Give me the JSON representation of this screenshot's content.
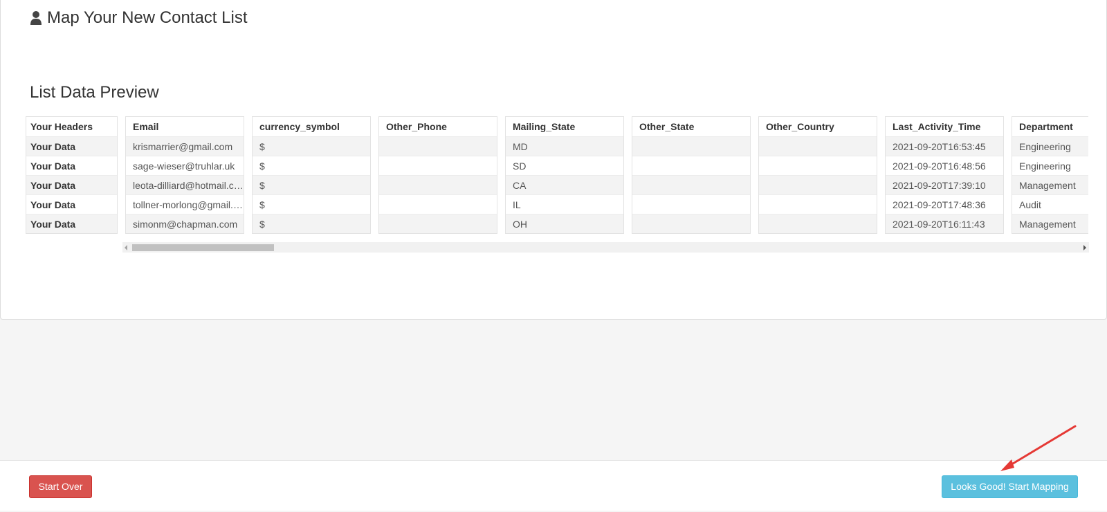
{
  "header": {
    "title": "Map Your New Contact List",
    "icon": "user-icon"
  },
  "preview": {
    "title": "List Data Preview",
    "row_header_label": "Your Headers",
    "row_labels": [
      "Your Data",
      "Your Data",
      "Your Data",
      "Your Data",
      "Your Data"
    ],
    "columns": [
      {
        "header": "Email",
        "values": [
          "krismarrier@gmail.com",
          "sage-wieser@truhlar.uk",
          "leota-dilliard@hotmail.com",
          "tollner-morlong@gmail.com",
          "simonm@chapman.com"
        ]
      },
      {
        "header": "currency_symbol",
        "values": [
          "$",
          "$",
          "$",
          "$",
          "$"
        ]
      },
      {
        "header": "Other_Phone",
        "values": [
          "",
          "",
          "",
          "",
          ""
        ]
      },
      {
        "header": "Mailing_State",
        "values": [
          "MD",
          "SD",
          "CA",
          "IL",
          "OH"
        ]
      },
      {
        "header": "Other_State",
        "values": [
          "",
          "",
          "",
          "",
          ""
        ]
      },
      {
        "header": "Other_Country",
        "values": [
          "",
          "",
          "",
          "",
          ""
        ]
      },
      {
        "header": "Last_Activity_Time",
        "values": [
          "2021-09-20T16:53:45",
          "2021-09-20T16:48:56",
          "2021-09-20T17:39:10",
          "2021-09-20T17:48:36",
          "2021-09-20T16:11:43"
        ]
      },
      {
        "header": "Department",
        "values": [
          "Engineering",
          "Engineering",
          "Management",
          "Audit",
          "Management"
        ]
      }
    ]
  },
  "footer": {
    "start_over_label": "Start Over",
    "start_mapping_label": "Looks Good! Start Mapping"
  },
  "colors": {
    "danger": "#d9534f",
    "info": "#5bc0de",
    "annotation_arrow": "#e53935"
  }
}
